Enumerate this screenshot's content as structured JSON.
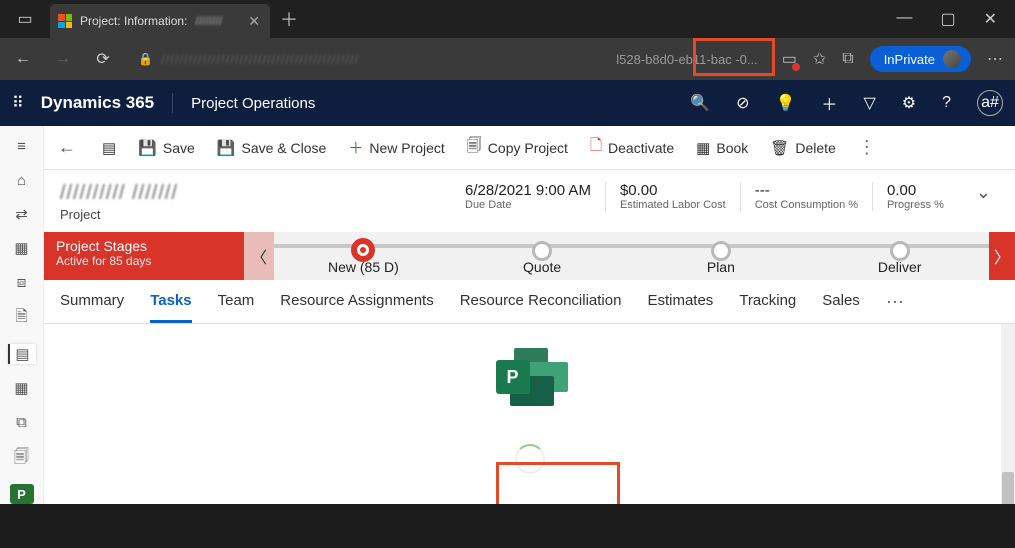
{
  "browser": {
    "tab_title": "Project: Information:",
    "url_tail": "l528-b8d0-eb11-bac -0...",
    "inprivate": "InPrivate"
  },
  "dyn_header": {
    "brand": "Dynamics 365",
    "module": "Project Operations",
    "avatar": "a#"
  },
  "commands": {
    "save": "Save",
    "save_close": "Save & Close",
    "new_project": "New Project",
    "copy_project": "Copy Project",
    "deactivate": "Deactivate",
    "book": "Book",
    "delete": "Delete"
  },
  "record": {
    "entity": "Project",
    "kpis": [
      {
        "value": "6/28/2021 9:00 AM",
        "label": "Due Date"
      },
      {
        "value": "$0.00",
        "label": "Estimated Labor Cost"
      },
      {
        "value": "---",
        "label": "Cost Consumption %"
      },
      {
        "value": "0.00",
        "label": "Progress %"
      }
    ]
  },
  "process": {
    "title": "Project Stages",
    "subtitle": "Active for 85 days",
    "stages": [
      "New  (85 D)",
      "Quote",
      "Plan",
      "Deliver"
    ]
  },
  "tabs": {
    "items": [
      "Summary",
      "Tasks",
      "Team",
      "Resource Assignments",
      "Resource Reconciliation",
      "Estimates",
      "Tracking",
      "Sales"
    ],
    "more": "⋯"
  },
  "proj_logo_letter": "P",
  "rail_chip": "P"
}
